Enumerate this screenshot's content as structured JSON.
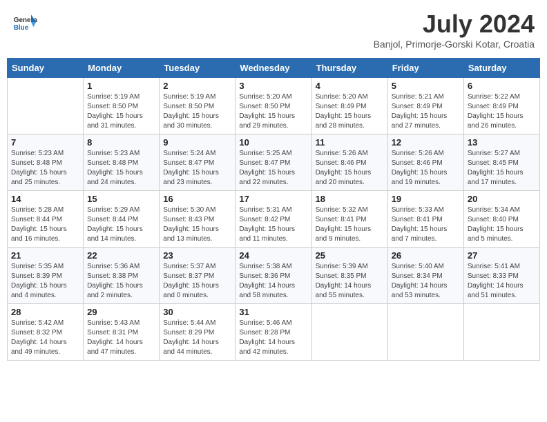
{
  "header": {
    "logo_general": "General",
    "logo_blue": "Blue",
    "month_year": "July 2024",
    "location": "Banjol, Primorje-Gorski Kotar, Croatia"
  },
  "days_of_week": [
    "Sunday",
    "Monday",
    "Tuesday",
    "Wednesday",
    "Thursday",
    "Friday",
    "Saturday"
  ],
  "weeks": [
    [
      {
        "day": "",
        "info": ""
      },
      {
        "day": "1",
        "info": "Sunrise: 5:19 AM\nSunset: 8:50 PM\nDaylight: 15 hours\nand 31 minutes."
      },
      {
        "day": "2",
        "info": "Sunrise: 5:19 AM\nSunset: 8:50 PM\nDaylight: 15 hours\nand 30 minutes."
      },
      {
        "day": "3",
        "info": "Sunrise: 5:20 AM\nSunset: 8:50 PM\nDaylight: 15 hours\nand 29 minutes."
      },
      {
        "day": "4",
        "info": "Sunrise: 5:20 AM\nSunset: 8:49 PM\nDaylight: 15 hours\nand 28 minutes."
      },
      {
        "day": "5",
        "info": "Sunrise: 5:21 AM\nSunset: 8:49 PM\nDaylight: 15 hours\nand 27 minutes."
      },
      {
        "day": "6",
        "info": "Sunrise: 5:22 AM\nSunset: 8:49 PM\nDaylight: 15 hours\nand 26 minutes."
      }
    ],
    [
      {
        "day": "7",
        "info": "Sunrise: 5:23 AM\nSunset: 8:48 PM\nDaylight: 15 hours\nand 25 minutes."
      },
      {
        "day": "8",
        "info": "Sunrise: 5:23 AM\nSunset: 8:48 PM\nDaylight: 15 hours\nand 24 minutes."
      },
      {
        "day": "9",
        "info": "Sunrise: 5:24 AM\nSunset: 8:47 PM\nDaylight: 15 hours\nand 23 minutes."
      },
      {
        "day": "10",
        "info": "Sunrise: 5:25 AM\nSunset: 8:47 PM\nDaylight: 15 hours\nand 22 minutes."
      },
      {
        "day": "11",
        "info": "Sunrise: 5:26 AM\nSunset: 8:46 PM\nDaylight: 15 hours\nand 20 minutes."
      },
      {
        "day": "12",
        "info": "Sunrise: 5:26 AM\nSunset: 8:46 PM\nDaylight: 15 hours\nand 19 minutes."
      },
      {
        "day": "13",
        "info": "Sunrise: 5:27 AM\nSunset: 8:45 PM\nDaylight: 15 hours\nand 17 minutes."
      }
    ],
    [
      {
        "day": "14",
        "info": "Sunrise: 5:28 AM\nSunset: 8:44 PM\nDaylight: 15 hours\nand 16 minutes."
      },
      {
        "day": "15",
        "info": "Sunrise: 5:29 AM\nSunset: 8:44 PM\nDaylight: 15 hours\nand 14 minutes."
      },
      {
        "day": "16",
        "info": "Sunrise: 5:30 AM\nSunset: 8:43 PM\nDaylight: 15 hours\nand 13 minutes."
      },
      {
        "day": "17",
        "info": "Sunrise: 5:31 AM\nSunset: 8:42 PM\nDaylight: 15 hours\nand 11 minutes."
      },
      {
        "day": "18",
        "info": "Sunrise: 5:32 AM\nSunset: 8:41 PM\nDaylight: 15 hours\nand 9 minutes."
      },
      {
        "day": "19",
        "info": "Sunrise: 5:33 AM\nSunset: 8:41 PM\nDaylight: 15 hours\nand 7 minutes."
      },
      {
        "day": "20",
        "info": "Sunrise: 5:34 AM\nSunset: 8:40 PM\nDaylight: 15 hours\nand 5 minutes."
      }
    ],
    [
      {
        "day": "21",
        "info": "Sunrise: 5:35 AM\nSunset: 8:39 PM\nDaylight: 15 hours\nand 4 minutes."
      },
      {
        "day": "22",
        "info": "Sunrise: 5:36 AM\nSunset: 8:38 PM\nDaylight: 15 hours\nand 2 minutes."
      },
      {
        "day": "23",
        "info": "Sunrise: 5:37 AM\nSunset: 8:37 PM\nDaylight: 15 hours\nand 0 minutes."
      },
      {
        "day": "24",
        "info": "Sunrise: 5:38 AM\nSunset: 8:36 PM\nDaylight: 14 hours\nand 58 minutes."
      },
      {
        "day": "25",
        "info": "Sunrise: 5:39 AM\nSunset: 8:35 PM\nDaylight: 14 hours\nand 55 minutes."
      },
      {
        "day": "26",
        "info": "Sunrise: 5:40 AM\nSunset: 8:34 PM\nDaylight: 14 hours\nand 53 minutes."
      },
      {
        "day": "27",
        "info": "Sunrise: 5:41 AM\nSunset: 8:33 PM\nDaylight: 14 hours\nand 51 minutes."
      }
    ],
    [
      {
        "day": "28",
        "info": "Sunrise: 5:42 AM\nSunset: 8:32 PM\nDaylight: 14 hours\nand 49 minutes."
      },
      {
        "day": "29",
        "info": "Sunrise: 5:43 AM\nSunset: 8:31 PM\nDaylight: 14 hours\nand 47 minutes."
      },
      {
        "day": "30",
        "info": "Sunrise: 5:44 AM\nSunset: 8:29 PM\nDaylight: 14 hours\nand 44 minutes."
      },
      {
        "day": "31",
        "info": "Sunrise: 5:46 AM\nSunset: 8:28 PM\nDaylight: 14 hours\nand 42 minutes."
      },
      {
        "day": "",
        "info": ""
      },
      {
        "day": "",
        "info": ""
      },
      {
        "day": "",
        "info": ""
      }
    ]
  ]
}
